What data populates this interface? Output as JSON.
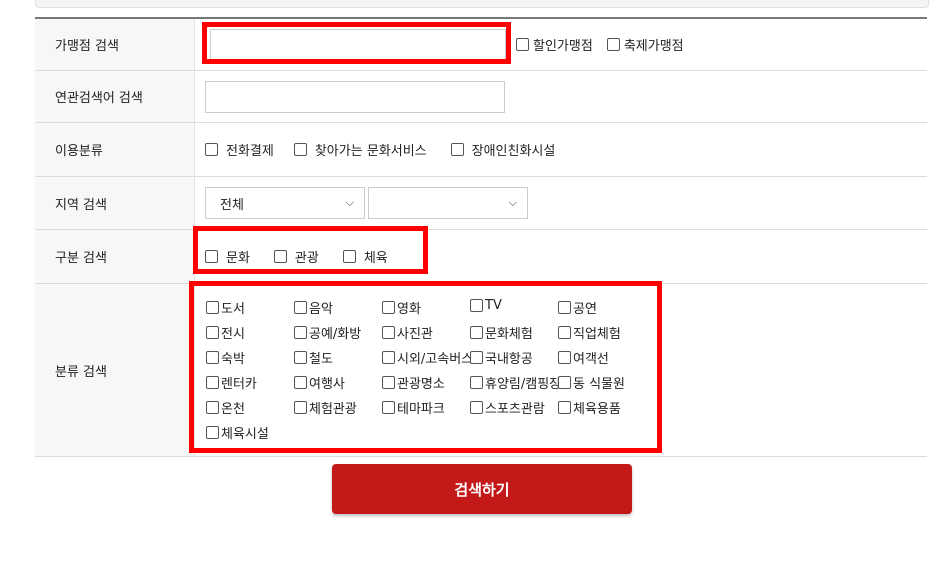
{
  "rows": {
    "store_search": {
      "label": "가맹점 검색",
      "input_value": "",
      "options": [
        "할인가맹점",
        "축제가맹점"
      ]
    },
    "related_search": {
      "label": "연관검색어 검색",
      "input_value": ""
    },
    "usage_category": {
      "label": "이용분류",
      "options": [
        "전화결제",
        "찾아가는 문화서비스",
        "장애인친화시설"
      ]
    },
    "region_search": {
      "label": "지역 검색",
      "select1": "전체",
      "select2": ""
    },
    "division_search": {
      "label": "구분 검색",
      "options": [
        "문화",
        "관광",
        "체육"
      ]
    },
    "category_search": {
      "label": "분류 검색",
      "items": [
        [
          "도서",
          "음악",
          "영화",
          "TV",
          "공연"
        ],
        [
          "전시",
          "공예/화방",
          "사진관",
          "문화체험",
          "직업체험"
        ],
        [
          "숙박",
          "철도",
          "시외/고속버스",
          "국내항공",
          "여객선"
        ],
        [
          "렌터카",
          "여행사",
          "관광명소",
          "휴양림/캠핑장",
          "동 식물원"
        ],
        [
          "온천",
          "체험관광",
          "테마파크",
          "스포츠관람",
          "체육용품"
        ],
        [
          "체육시설"
        ]
      ]
    }
  },
  "submit_label": "검색하기"
}
